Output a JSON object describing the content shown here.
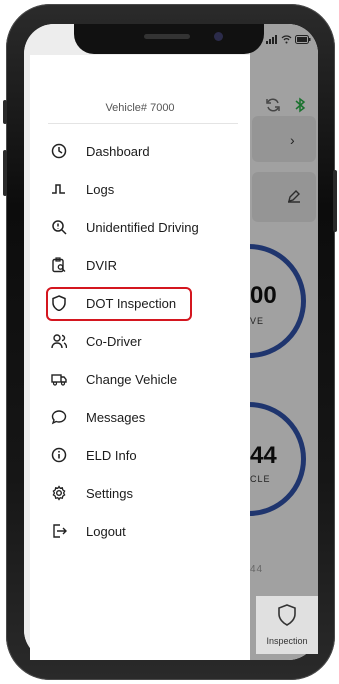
{
  "drawer": {
    "vehicle_label": "Vehicle# 7000",
    "items": [
      {
        "label": "Dashboard",
        "icon": "clock-icon"
      },
      {
        "label": "Logs",
        "icon": "logs-icon"
      },
      {
        "label": "Unidentified Driving",
        "icon": "search-alert-icon"
      },
      {
        "label": "DVIR",
        "icon": "clipboard-search-icon"
      },
      {
        "label": "DOT Inspection",
        "icon": "shield-icon"
      },
      {
        "label": "Co-Driver",
        "icon": "users-icon"
      },
      {
        "label": "Change Vehicle",
        "icon": "truck-icon"
      },
      {
        "label": "Messages",
        "icon": "message-icon"
      },
      {
        "label": "ELD Info",
        "icon": "info-icon"
      },
      {
        "label": "Settings",
        "icon": "gear-icon"
      },
      {
        "label": "Logout",
        "icon": "logout-icon"
      }
    ],
    "highlight_color": "#d4161f"
  },
  "background": {
    "gauge_1_value": "00",
    "gauge_1_label": "VE",
    "gauge_2_value": "44",
    "gauge_2_label": "CLE",
    "faded_text": "44",
    "bottom_tab_label": "Inspection",
    "accent": "#2e4fa3"
  }
}
